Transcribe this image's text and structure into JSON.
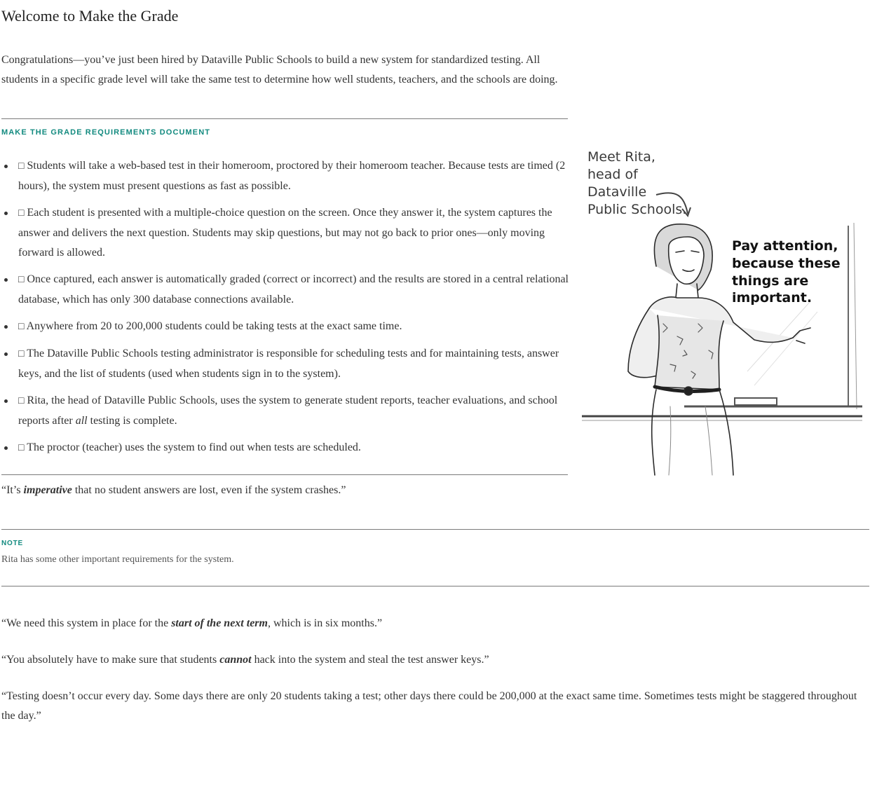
{
  "page": {
    "title": "Welcome to Make the Grade",
    "intro": "Congratulations—you’ve just been hired by Dataville Public Schools to build a new system for standardized testing. All students in a specific grade level will take the same test to determine how well students, teachers, and the schools are doing."
  },
  "requirements": {
    "heading": "Make the Grade Requirements Document",
    "checkbox_glyph": "□",
    "items": [
      {
        "text": "Students will take a web-based test in their homeroom, proctored by their homeroom teacher. Because tests are timed (2 hours), the system must present questions as fast as possible."
      },
      {
        "text": "Each student is presented with a multiple-choice question on the screen. Once they answer it, the system captures the answer and delivers the next question. Students may skip questions, but may not go back to prior ones—only moving forward is allowed."
      },
      {
        "text": "Once captured, each answer is automatically graded (correct or incorrect) and the results are stored in a central relational database, which has only 300 database connections available."
      },
      {
        "text": "Anywhere from 20 to 200,000 students could be taking tests at the exact same time."
      },
      {
        "text": "The Dataville Public Schools testing administrator is responsible for scheduling tests and for maintaining tests, answer keys, and the list of students (used when students sign in to the system)."
      },
      {
        "text_before": "Rita, the head of Dataville Public Schools, uses the system to generate student reports, teacher evaluations, and school reports after ",
        "emphasis": "all",
        "text_after": " testing is complete."
      },
      {
        "text": "The proctor (teacher) uses the system to find out when tests are scheduled."
      }
    ]
  },
  "illustration": {
    "caption_lines": [
      "Meet Rita,",
      "head of",
      "Dataville",
      "Public Schools."
    ],
    "speech_lines": [
      "Pay attention,",
      "because these",
      "things are",
      "important."
    ]
  },
  "quote_imperative": {
    "before": "“It’s ",
    "emphasis": "imperative",
    "after": " that no student answers are lost, even if the system crashes.”"
  },
  "note": {
    "label": "Note",
    "text": "Rita has some other important requirements for the system."
  },
  "quotes": [
    {
      "before": "“We need this system in place for the ",
      "emphasis": "start of the next term",
      "after": ", which is in six months.”"
    },
    {
      "before": "“You absolutely have to make sure that students ",
      "emphasis": "cannot",
      "after": " hack into the system and steal the test answer keys.”"
    },
    {
      "before": "“Testing doesn’t occur every day. Some days there are only 20 students taking a test; other days there could be 200,000 at the exact same time. Sometimes tests might be staggered throughout the day.”"
    }
  ]
}
